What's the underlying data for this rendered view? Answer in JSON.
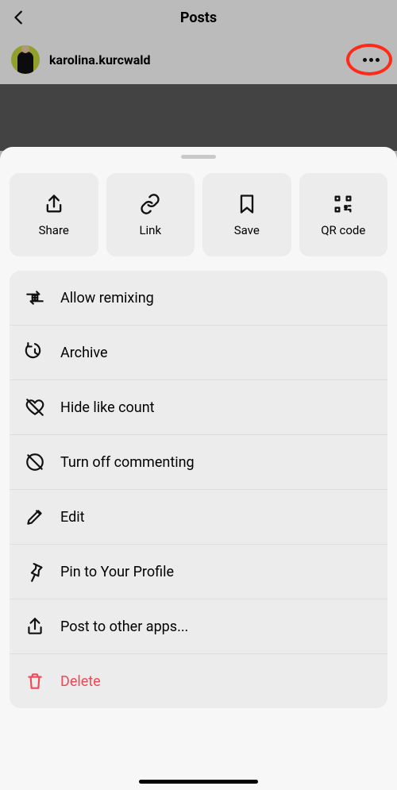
{
  "header": {
    "title": "Posts"
  },
  "post": {
    "username": "karolina.kurcwald"
  },
  "actions": {
    "share": "Share",
    "link": "Link",
    "save": "Save",
    "qrcode": "QR code"
  },
  "menu": {
    "allow_remixing": "Allow remixing",
    "archive": "Archive",
    "hide_like_count": "Hide like count",
    "turn_off_commenting": "Turn off commenting",
    "edit": "Edit",
    "pin": "Pin to Your Profile",
    "post_other": "Post to other apps...",
    "delete": "Delete"
  }
}
